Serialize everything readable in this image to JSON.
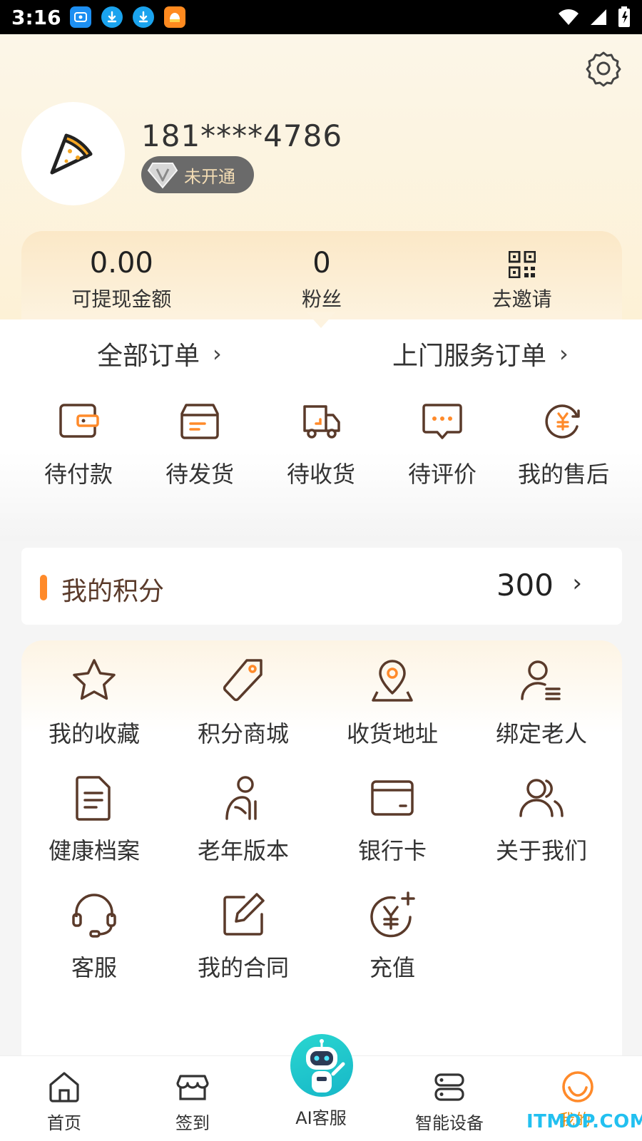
{
  "status_bar": {
    "time": "3:16"
  },
  "profile": {
    "phone": "181****4786",
    "vip_status": "未开通"
  },
  "stats": [
    {
      "value": "0.00",
      "label": "可提现金额"
    },
    {
      "value": "0",
      "label": "粉丝"
    },
    {
      "label": "去邀请",
      "icon": "qr-code-icon"
    }
  ],
  "orders": {
    "all_label": "全部订单",
    "home_service_label": "上门服务订单",
    "items": [
      {
        "label": "待付款",
        "icon": "wallet-icon"
      },
      {
        "label": "待发货",
        "icon": "package-icon"
      },
      {
        "label": "待收货",
        "icon": "truck-icon"
      },
      {
        "label": "待评价",
        "icon": "comment-icon"
      },
      {
        "label": "我的售后",
        "icon": "after-sale-icon"
      }
    ]
  },
  "points": {
    "title": "我的积分",
    "value": "300"
  },
  "menu": {
    "items": [
      {
        "label": "我的收藏",
        "icon": "star-icon"
      },
      {
        "label": "积分商城",
        "icon": "tag-icon"
      },
      {
        "label": "收货地址",
        "icon": "location-icon"
      },
      {
        "label": "绑定老人",
        "icon": "user-list-icon"
      },
      {
        "label": "健康档案",
        "icon": "document-icon"
      },
      {
        "label": "老年版本",
        "icon": "elderly-icon"
      },
      {
        "label": "银行卡",
        "icon": "card-icon"
      },
      {
        "label": "关于我们",
        "icon": "users-icon"
      },
      {
        "label": "客服",
        "icon": "headset-icon"
      },
      {
        "label": "我的合同",
        "icon": "edit-icon"
      },
      {
        "label": "充值",
        "icon": "recharge-icon"
      }
    ]
  },
  "bottom_nav": {
    "items": [
      {
        "label": "首页",
        "icon": "home-icon"
      },
      {
        "label": "签到",
        "icon": "shop-icon"
      },
      {
        "label": "AI客服",
        "icon": "robot-icon"
      },
      {
        "label": "智能设备",
        "icon": "device-icon"
      },
      {
        "label": "我的",
        "icon": "smile-icon"
      }
    ]
  },
  "watermark": {
    "text": "ITMOP.COM",
    "sub": "我的"
  },
  "colors": {
    "accent": "#ff8a2a",
    "icon_stroke": "#5a3a2a",
    "active_tab": "#ff8a2a",
    "header_bg": "#fdf1d6"
  }
}
